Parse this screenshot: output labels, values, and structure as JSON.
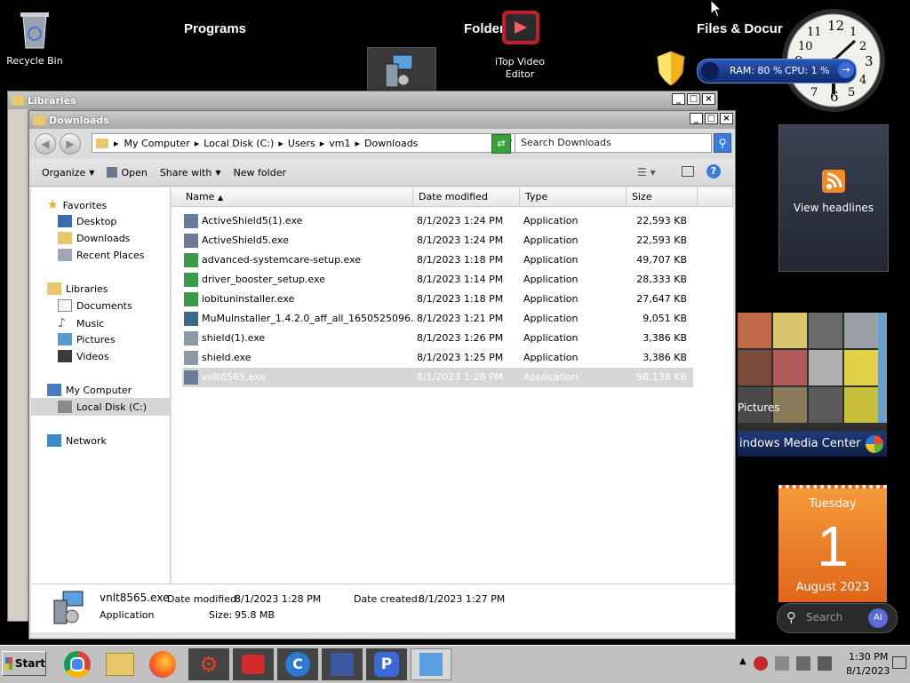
{
  "desktop": {
    "recycle_bin": "Recycle Bin",
    "headings": {
      "programs": "Programs",
      "folders": "Folders",
      "files_docs": "Files & Docur"
    },
    "itop_label_1": "iTop Video",
    "itop_label_2": "Editor"
  },
  "gadgets": {
    "meter": {
      "ram": "RAM: 80 %",
      "cpu": "CPU: 1 %"
    },
    "headlines": "View headlines",
    "media_center": {
      "pictures": "Pictures",
      "title": "indows Media Center"
    },
    "calendar": {
      "weekday": "Tuesday",
      "day": "1",
      "month_year": "August 2023"
    },
    "search": {
      "placeholder": "Search",
      "ai": "AI"
    }
  },
  "libraries_window": {
    "title": "Libraries"
  },
  "explorer": {
    "title": "Downloads",
    "breadcrumb": [
      "My Computer",
      "Local Disk (C:)",
      "Users",
      "vm1",
      "Downloads"
    ],
    "search_placeholder": "Search Downloads",
    "toolbar": {
      "organize": "Organize",
      "open": "Open",
      "share_with": "Share with",
      "new_folder": "New folder"
    },
    "nav": {
      "favorites": "Favorites",
      "desktop": "Desktop",
      "downloads": "Downloads",
      "recent_places": "Recent Places",
      "libraries": "Libraries",
      "documents": "Documents",
      "music": "Music",
      "pictures": "Pictures",
      "videos": "Videos",
      "my_computer": "My Computer",
      "local_disk": "Local Disk (C:)",
      "network": "Network"
    },
    "columns": {
      "name": "Name",
      "date_modified": "Date modified",
      "type": "Type",
      "size": "Size"
    },
    "files": [
      {
        "name": "ActiveShield5(1).exe",
        "date": "8/1/2023 1:24 PM",
        "type": "Application",
        "size": "22,593 KB"
      },
      {
        "name": "ActiveShield5.exe",
        "date": "8/1/2023 1:24 PM",
        "type": "Application",
        "size": "22,593 KB"
      },
      {
        "name": "advanced-systemcare-setup.exe",
        "date": "8/1/2023 1:18 PM",
        "type": "Application",
        "size": "49,707 KB"
      },
      {
        "name": "driver_booster_setup.exe",
        "date": "8/1/2023 1:14 PM",
        "type": "Application",
        "size": "28,333 KB"
      },
      {
        "name": "iobituninstaller.exe",
        "date": "8/1/2023 1:18 PM",
        "type": "Application",
        "size": "27,647 KB"
      },
      {
        "name": "MuMuInstaller_1.4.2.0_aff_all_1650525096...",
        "date": "8/1/2023 1:21 PM",
        "type": "Application",
        "size": "9,051 KB"
      },
      {
        "name": "shield(1).exe",
        "date": "8/1/2023 1:26 PM",
        "type": "Application",
        "size": "3,386 KB"
      },
      {
        "name": "shield.exe",
        "date": "8/1/2023 1:25 PM",
        "type": "Application",
        "size": "3,386 KB"
      },
      {
        "name": "vnlt8565.exe",
        "date": "8/1/2023 1:28 PM",
        "type": "Application",
        "size": "98,138 KB"
      }
    ],
    "status": {
      "filename": "vnlt8565.exe",
      "date_modified_label": "Date modified:",
      "date_modified": "8/1/2023 1:28 PM",
      "date_created_label": "Date created:",
      "date_created": "8/1/2023 1:27 PM",
      "type": "Application",
      "size_label": "Size:",
      "size": "95.8 MB"
    }
  },
  "taskbar": {
    "start": "Start",
    "clock_time": "1:30 PM",
    "clock_date": "8/1/2023"
  },
  "colors": {
    "selection": "#d6d6d6",
    "rss": "#f08a24",
    "calendar": "#f07b1e",
    "meter": "#1d3f8f"
  }
}
